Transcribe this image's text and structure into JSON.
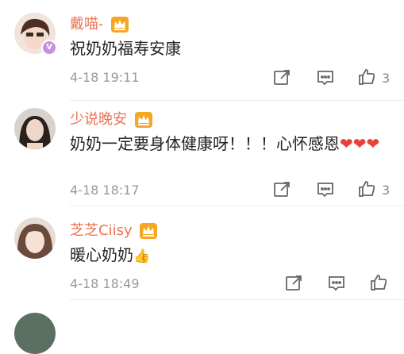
{
  "comments": [
    {
      "name": "戴喵-",
      "text": "祝奶奶福寿安康",
      "time": "4-18 19:11",
      "likes": "3",
      "verified": true
    },
    {
      "name": "少说晚安",
      "text": "奶奶一定要身体健康呀！！！心怀感恩",
      "emoji": "❤❤❤",
      "time": "4-18 18:17",
      "likes": "3"
    },
    {
      "name": "芝芝Ciisy",
      "text": "暖心奶奶",
      "emoji": "👍",
      "time": "4-18 18:49",
      "likes": ""
    },
    {
      "name": "",
      "text": "",
      "time": "",
      "likes": ""
    }
  ],
  "icons": {
    "share": "share-icon",
    "comment": "comment-icon",
    "like": "thumbs-up-icon",
    "crown": "crown-badge-icon"
  },
  "colors": {
    "name": "#eb7350",
    "text": "#222222",
    "meta": "#999999",
    "crown": "#f5a623",
    "heart": "#e8413b"
  }
}
